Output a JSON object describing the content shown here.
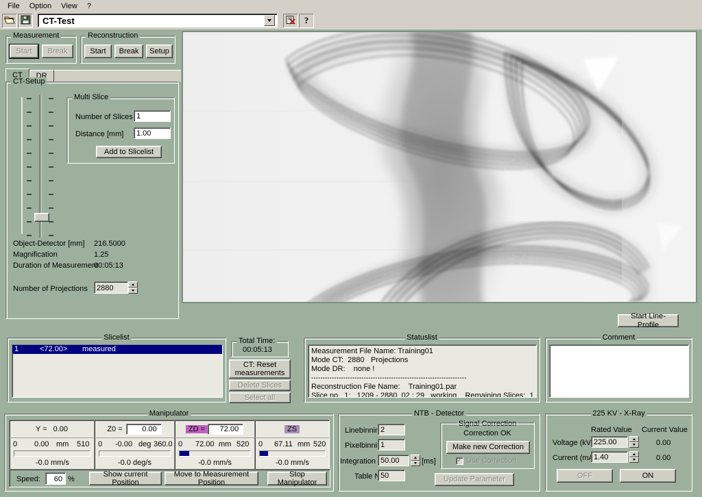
{
  "menubar": {
    "items": [
      "File",
      "Option",
      "View",
      "?"
    ]
  },
  "toolbar": {
    "open_icon": "open-folder-icon",
    "save_icon": "save-disk-icon",
    "project_value": "CT-Test",
    "project_placeholder": "",
    "dropdown_icon": "chevron-down-icon",
    "clear_icon": "delete-red-x-icon",
    "help_icon": "question-mark-icon"
  },
  "measurement": {
    "title": "Measurement",
    "start": "Start",
    "break": "Break"
  },
  "reconstruction": {
    "title": "Reconstruction",
    "start": "Start",
    "break": "Break",
    "setup": "Setup"
  },
  "tabs": [
    {
      "label": "CT",
      "active": true
    },
    {
      "label": "DR",
      "active": false
    }
  ],
  "ct_setup": {
    "title": "CT-Setup",
    "multislice": {
      "title": "Multi Slice",
      "number_of_slices_label": "Number of Slices",
      "number_of_slices_value": "1",
      "distance_label": "Distance [mm]",
      "distance_value": "1.00",
      "add_button": "Add to Slicelist"
    },
    "readouts": [
      {
        "label": "Object-Detector [mm]",
        "value": "216.5000"
      },
      {
        "label": "Magnification",
        "value": "1.25"
      },
      {
        "label": "Duration of Measurement",
        "value": "00:05:13"
      }
    ],
    "projections_label": "Number of Projections",
    "projections_value": "2880"
  },
  "image_view": {
    "name": "ct-radiograph-image",
    "description": "X-ray radiograph / sinogram overlay of a twisted helical object"
  },
  "line_profile_button": "Start Line-Profile",
  "slicelist": {
    "title": "Slicelist",
    "rows": [
      {
        "index": "1",
        "angle": "<72.00>",
        "status": "measured",
        "selected": true
      }
    ],
    "total_time_title": "Total Time:",
    "total_time_value": "00:05:13",
    "reset_button": "CT: Reset\nmeasurements",
    "reset_button_l1": "CT: Reset",
    "reset_button_l2": "measurements",
    "delete_button": "Delete Slices",
    "select_all_button": "Select all"
  },
  "statuslist": {
    "title": "Statuslist",
    "lines": [
      "Measurement File Name: Training01",
      "Mode CT:  2880   Projections",
      "Mode DR:    none !",
      "--------------------------------------------------------------------",
      "Reconstruction File Name:    Training01.par",
      "Slice no.  1:   1209 - 2880  02 : 29   working    Remaining Slices:  1"
    ]
  },
  "comment": {
    "title": "Comment",
    "value": "",
    "placeholder": ""
  },
  "manipulator": {
    "title": "Manipulator",
    "axes": [
      {
        "name": "Y",
        "label": "Y =",
        "value": "0.00",
        "has_input": false,
        "tag_color": "none",
        "min": "0",
        "current": "0.00",
        "unit": "mm",
        "max": "510",
        "fill_percent": 0,
        "speed": "-0.0 mm/s"
      },
      {
        "name": "Z0",
        "label": "Z0 =",
        "value": "0.00",
        "has_input": true,
        "tag_color": "none",
        "min": "0",
        "current": "-0.00",
        "unit": "deg",
        "max": "360.0",
        "fill_percent": 0,
        "speed": "-0.0 deg/s"
      },
      {
        "name": "ZD",
        "label": "ZD =",
        "value": "72.00",
        "has_input": true,
        "tag_color": "#c060c0",
        "min": "0",
        "current": "72.00",
        "unit": "mm",
        "max": "520",
        "fill_percent": 14,
        "speed": "-0.0 mm/s"
      },
      {
        "name": "ZS",
        "label": "ZS",
        "value": "",
        "has_input": false,
        "tag_color": "#aa8fba",
        "min": "0",
        "current": "67.11",
        "unit": "mm",
        "max": "520",
        "fill_percent": 13,
        "speed": "-0.0 mm/s"
      }
    ],
    "speed_label": "Speed:",
    "speed_value": "60",
    "speed_unit": "%",
    "show_position_button": "Show current Position",
    "move_position_button": "Move to Measurement Position",
    "stop_button": "Stop Manipulator"
  },
  "detector": {
    "title": "NTB - Detector",
    "fields": [
      {
        "label": "Linebinning:",
        "value": "2"
      },
      {
        "label": "Pixelbinning:",
        "value": "1"
      },
      {
        "label": "Integration Time:",
        "value": "50.00",
        "unit": "[ms]",
        "spinner": true
      },
      {
        "label": "Table No. :",
        "value": "50"
      }
    ],
    "signal_correction": {
      "title": "Signal Correction",
      "status": "Correction OK",
      "make_button": "Make new Correction",
      "use_checkbox_label": "Use Correction",
      "use_checkbox_checked": true
    },
    "update_button": "Update Parameter"
  },
  "xray": {
    "title": "225 KV - X-Ray",
    "rated_header": "Rated Value",
    "current_header": "Current Value",
    "rows": [
      {
        "label": "Voltage (kV)",
        "rated": "225.00",
        "current": "0.00"
      },
      {
        "label": "Current (mA)",
        "rated": "1.40",
        "current": "0.00"
      }
    ],
    "off_button": "OFF",
    "on_button": "ON"
  },
  "colors": {
    "panel_bg": "#9db09d",
    "chrome_bg": "#d4d0c8",
    "button_face": "#cfcfc4",
    "selection_blue": "#000080",
    "bar_fill": "#000080",
    "axis_tag_active": "#c060c0",
    "axis_tag_dim": "#aa8fba",
    "field_bg": "#ffffff",
    "image_bg": "#efefef"
  }
}
